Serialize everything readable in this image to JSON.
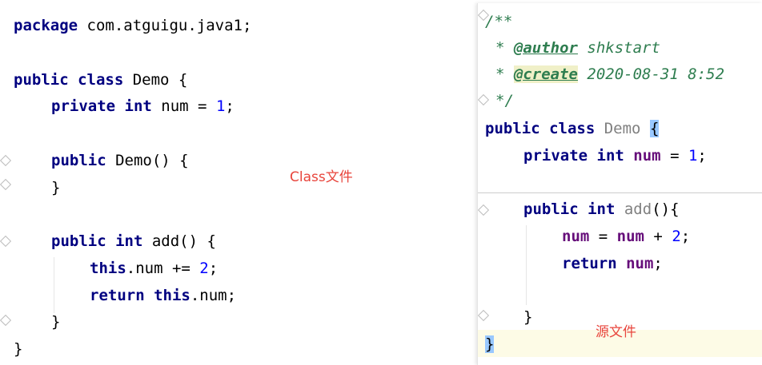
{
  "left_editor": {
    "line1": {
      "kw": "package",
      "rest": " com.atguigu.java1;"
    },
    "line2": {
      "kw1": "public",
      "kw2": "class",
      "rest": " Demo {"
    },
    "line3": {
      "kw1": "private",
      "kw2": "int",
      "rest": " num = ",
      "num": "1",
      "end": ";"
    },
    "line4": {
      "kw": "public",
      "rest": " Demo() {"
    },
    "line5": {
      "text": "}"
    },
    "line6": {
      "kw1": "public",
      "kw2": "int",
      "rest": " add() {"
    },
    "line7": {
      "kw": "this",
      "rest": ".num += ",
      "num": "2",
      "end": ";"
    },
    "line8": {
      "kw1": "return",
      "kw2": "this",
      "rest": ".num;"
    },
    "line9": {
      "text": "}"
    },
    "line10": {
      "text": "}"
    },
    "annotation": "Class文件"
  },
  "right_editor": {
    "doc_open": "/**",
    "doc_star": "*",
    "author_tag": "@author",
    "author_value": " shkstart",
    "create_tag": "@create",
    "create_value": " 2020-08-31 8:52",
    "doc_close": "*/",
    "class_line": {
      "kw1": "public",
      "kw2": "class",
      "name": " Demo ",
      "brace": "{"
    },
    "field_line": {
      "kw1": "private",
      "kw2": "int",
      "field": " num",
      "rest": " = ",
      "num": "1",
      "end": ";"
    },
    "method_line": {
      "kw1": "public",
      "kw2": "int",
      "name": " add",
      "rest": "(){"
    },
    "body1": {
      "field1": "num",
      "mid": " = ",
      "field2": "num",
      "op": " + ",
      "num": "2",
      "end": ";"
    },
    "body2": {
      "kw": "return",
      "field": " num",
      "end": ";"
    },
    "close_method": "}",
    "close_class": "}",
    "annotation": "源文件"
  }
}
